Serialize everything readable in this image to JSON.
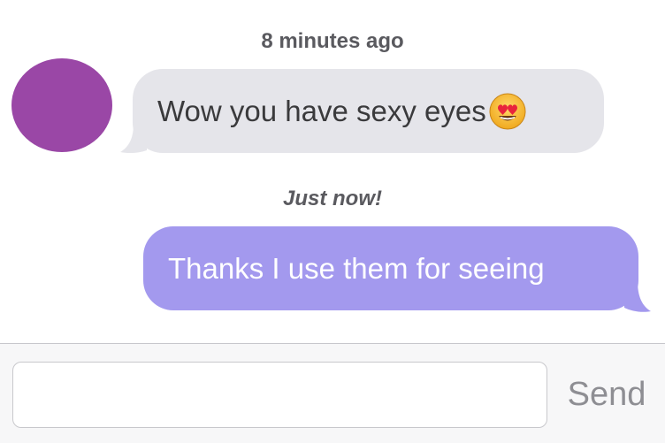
{
  "conversation": {
    "messages": [
      {
        "timestamp": "8 minutes ago",
        "direction": "incoming",
        "text": "Wow you have sexy eyes",
        "emoji": "heart-eyes-emoji"
      },
      {
        "timestamp": "Just now!",
        "direction": "outgoing",
        "text": "Thanks I use them for seeing"
      }
    ]
  },
  "composer": {
    "input_value": "",
    "send_label": "Send"
  },
  "colors": {
    "incoming_bubble": "#e5e5ea",
    "outgoing_bubble": "#a399ee",
    "avatar": "#9a47a6",
    "send_text": "#8e8e93"
  }
}
